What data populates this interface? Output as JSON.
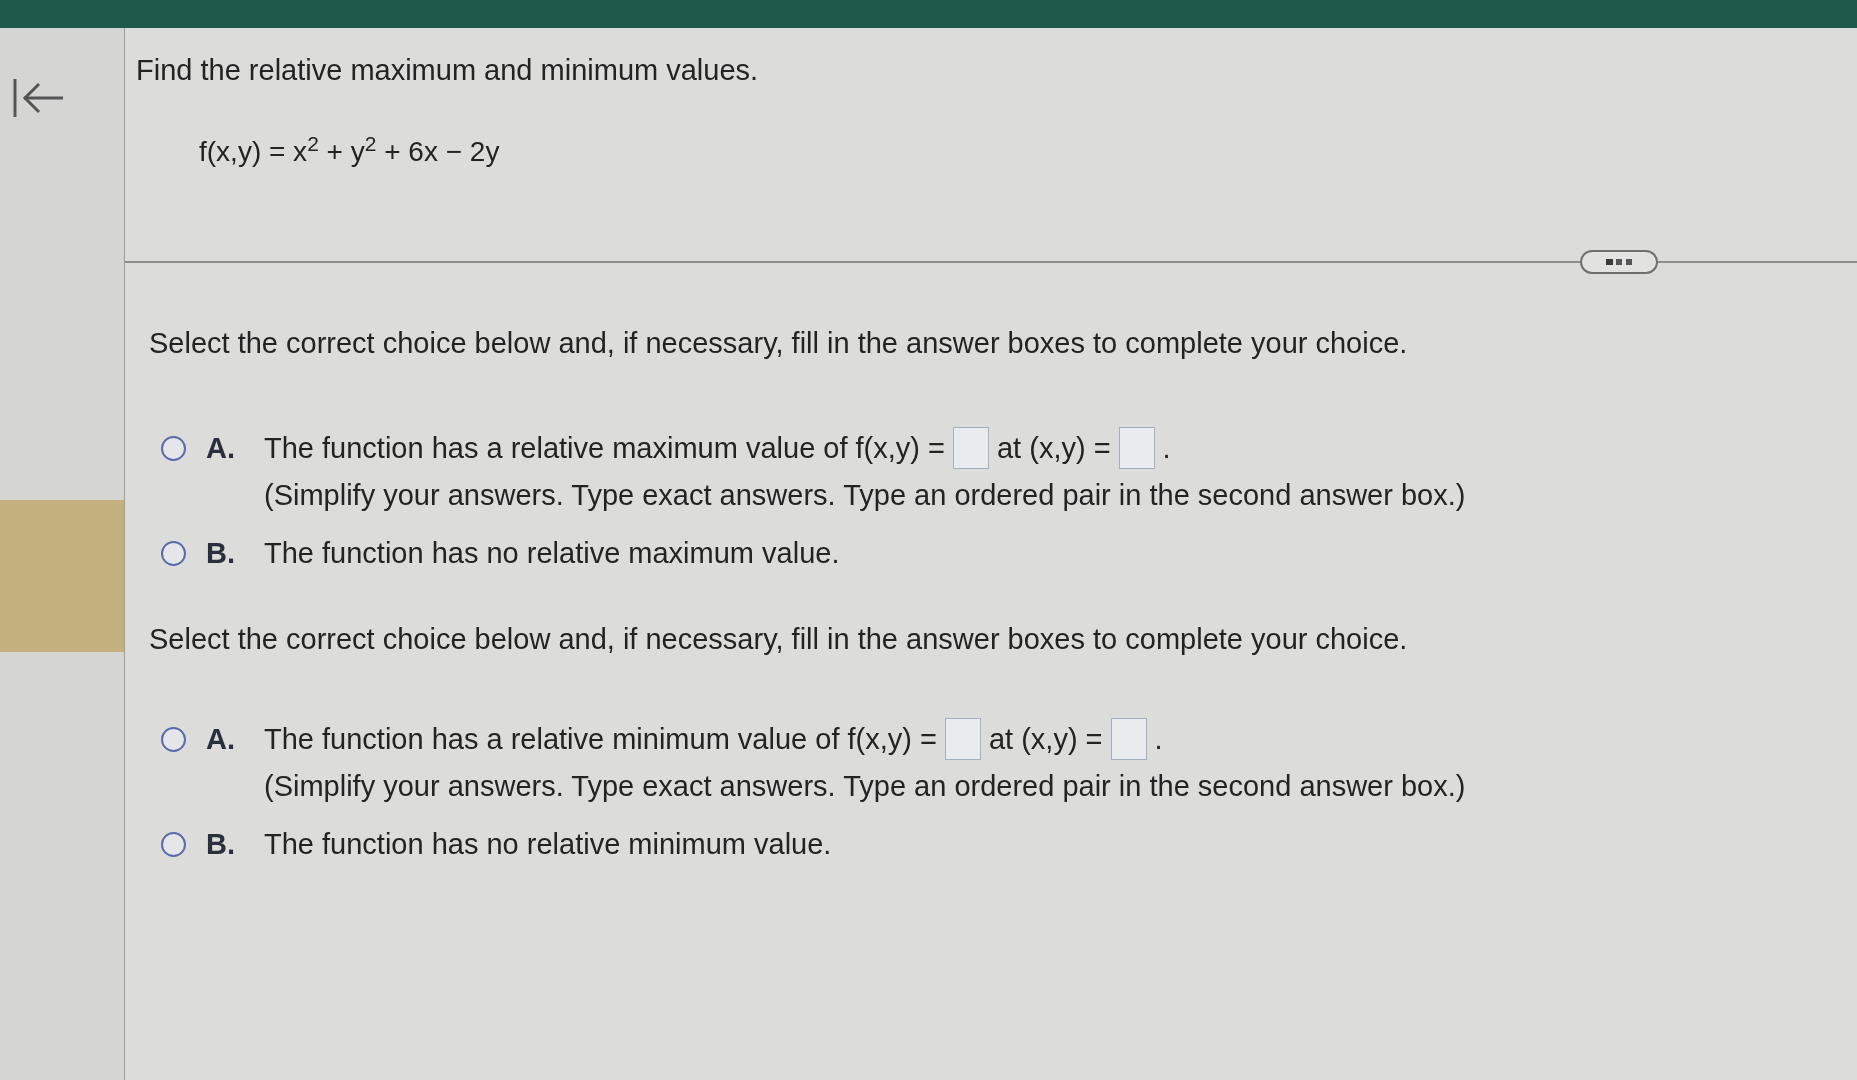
{
  "question": {
    "instruction": "Find the relative maximum and minimum values.",
    "function": "f(x,y) = x$^{2}$ + y$^{2}$ + 6x − 2y"
  },
  "parts": [
    {
      "prompt": "Select the correct choice below and, if necessary, fill in the answer boxes to complete your choice.",
      "choices": [
        {
          "label": "A.",
          "selected": false,
          "sentence": [
            {
              "kind": "text",
              "text": "The function has a relative maximum value of f(x,y) ="
            },
            {
              "kind": "answer_box"
            },
            {
              "kind": "text",
              "text": "at (x,y) ="
            },
            {
              "kind": "answer_box"
            },
            {
              "kind": "text",
              "text": "."
            }
          ],
          "hint": "(Simplify your answers. Type exact answers. Type an ordered pair in the second answer box.)"
        },
        {
          "label": "B.",
          "selected": false,
          "sentence": [
            {
              "kind": "text",
              "text": "The function has no relative maximum value."
            }
          ]
        }
      ]
    },
    {
      "prompt": "Select the correct choice below and, if necessary, fill in the answer boxes to complete your choice.",
      "choices": [
        {
          "label": "A.",
          "selected": false,
          "sentence": [
            {
              "kind": "text",
              "text": "The function has a relative minimum value of f(x,y) ="
            },
            {
              "kind": "answer_box"
            },
            {
              "kind": "text",
              "text": "at (x,y) ="
            },
            {
              "kind": "answer_box"
            },
            {
              "kind": "text",
              "text": "."
            }
          ],
          "hint": "(Simplify your answers. Type exact answers. Type an ordered pair in the second answer box.)"
        },
        {
          "label": "B.",
          "selected": false,
          "sentence": [
            {
              "kind": "text",
              "text": "The function has no relative minimum value."
            }
          ]
        }
      ]
    }
  ]
}
